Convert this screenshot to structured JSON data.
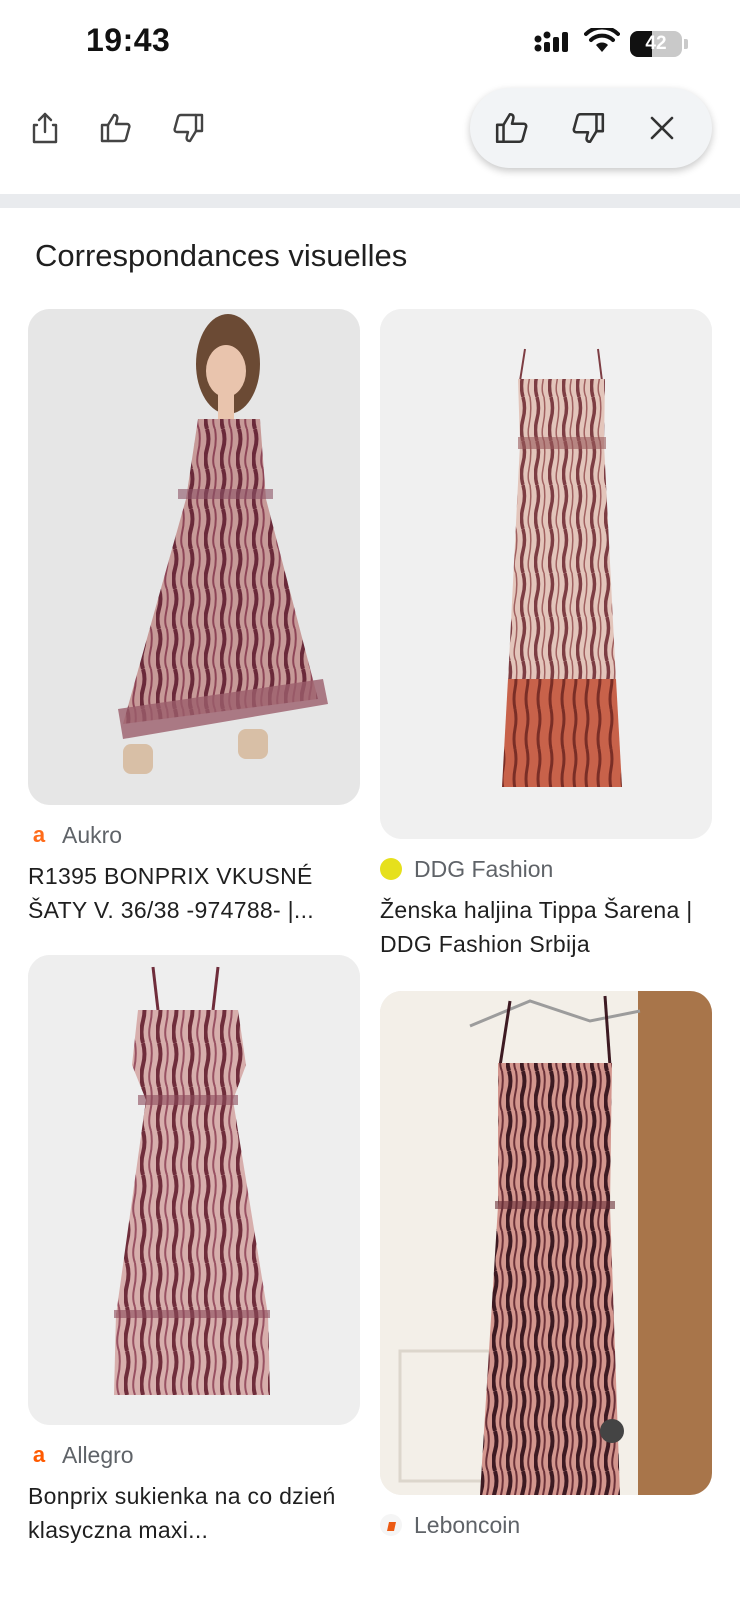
{
  "status_bar": {
    "time": "19:43",
    "battery_level": "42"
  },
  "section": {
    "title": "Correspondances visuelles"
  },
  "results": [
    {
      "source": "Aukro",
      "source_logo": "a",
      "source_color": "#ff6b1a",
      "title": "R1395 BONPRIX VKUSNÉ ŠATY V. 36/38 -974788- |..."
    },
    {
      "source": "DDG Fashion",
      "source_logo": "",
      "source_color": "#e6e01c",
      "title": "Ženska haljina Tippa Šarena | DDG Fashion Srbija"
    },
    {
      "source": "Allegro",
      "source_logo": "a",
      "source_color": "#ff5a00",
      "title": "Bonprix sukienka na co dzień klasyczna maxi..."
    },
    {
      "source": "Leboncoin",
      "source_logo": "",
      "source_color": "#ec5a13",
      "title": ""
    }
  ],
  "colors": {
    "pill_bg": "#f2f4f6",
    "divider": "#e9ebee",
    "secondary_text": "#5f6368"
  }
}
